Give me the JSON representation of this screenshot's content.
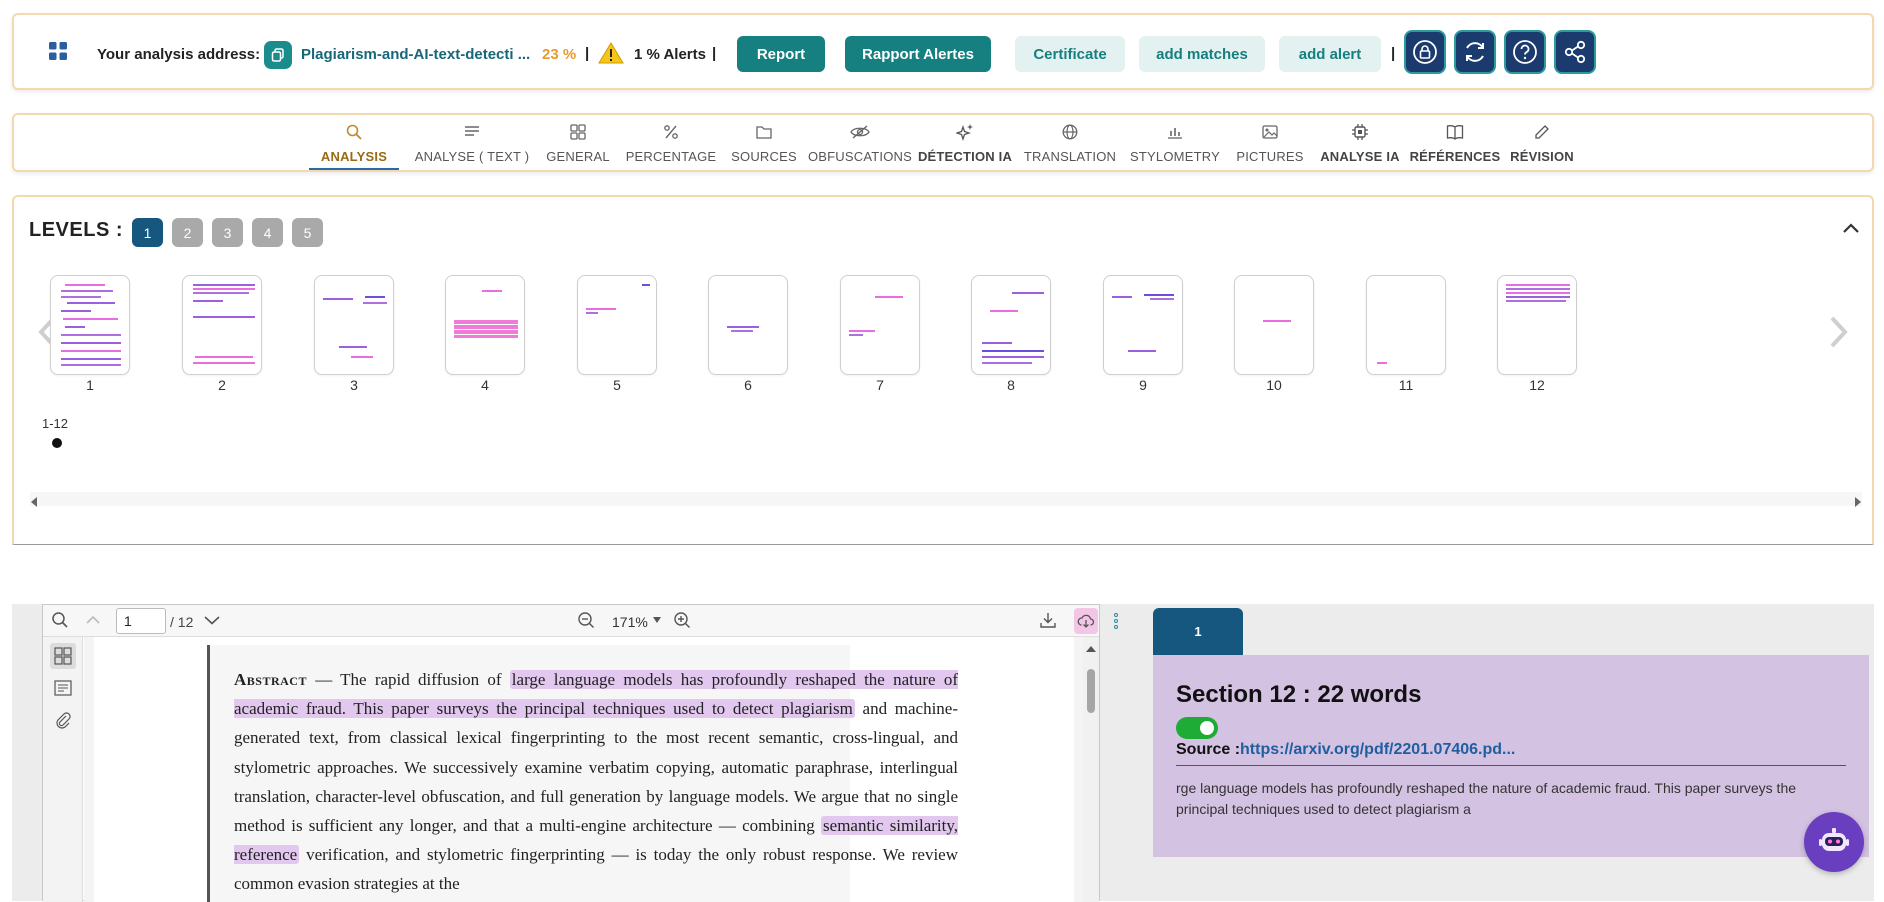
{
  "header": {
    "address_label": "Your analysis address:",
    "address_link": "Plagiarism-and-AI-text-detecti ...",
    "percentage": "23 %",
    "separator": "|",
    "alerts": "1 % Alerts",
    "report_button": "Report",
    "rapport_alertes_button": "Rapport Alertes",
    "certificate_button": "Certificate",
    "add_matches_button": "add matches",
    "add_alert_button": "add alert",
    "icons": [
      "apps-icon",
      "copy-icon",
      "warning-icon",
      "lock-icon",
      "refresh-icon",
      "help-icon",
      "share-icon"
    ],
    "colors": {
      "primary_button": "#167f80",
      "light_button": "#e3f2f1",
      "percentage": "#e89a2c",
      "icon_button": "#1b3a6e"
    }
  },
  "tabs": [
    {
      "label": "ANALYSIS",
      "icon": "search-icon",
      "active": true
    },
    {
      "label": "ANALYSE ( TEXT )",
      "icon": "text-lines-icon"
    },
    {
      "label": "GENERAL",
      "icon": "grid-icon"
    },
    {
      "label": "PERCENTAGE",
      "icon": "percent-icon"
    },
    {
      "label": "SOURCES",
      "icon": "folder-icon"
    },
    {
      "label": "OBFUSCATIONS",
      "icon": "eye-off-icon"
    },
    {
      "label": "DÉTECTION IA",
      "icon": "sparkle-icon"
    },
    {
      "label": "TRANSLATION",
      "icon": "globe-icon"
    },
    {
      "label": "STYLOMETRY",
      "icon": "bar-chart-icon"
    },
    {
      "label": "PICTURES",
      "icon": "image-icon"
    },
    {
      "label": "ANALYSE IA",
      "icon": "chip-icon"
    },
    {
      "label": "RÉFÉRENCES",
      "icon": "book-icon"
    },
    {
      "label": "RÉVISION",
      "icon": "pencil-icon"
    }
  ],
  "levels": {
    "title": "LEVELS :",
    "buttons": [
      "1",
      "2",
      "3",
      "4",
      "5"
    ],
    "selected": "1",
    "pages": [
      "1",
      "2",
      "3",
      "4",
      "5",
      "6",
      "7",
      "8",
      "9",
      "10",
      "11",
      "12"
    ],
    "range_label": "1-12"
  },
  "pdf": {
    "page_current": "1",
    "page_total": "/ 12",
    "zoom": "171%",
    "abstract_title": "Abstract",
    "abstract_dash": " — The rapid diffusion of ",
    "hl1": "large language models has profoundly reshaped the nature of academic fraud. This paper surveys the principal techniques used to detect plagiarism",
    "mid1": " and machine-generated text, from classical lexical fingerprinting to the most recent semantic, cross-lingual, and stylometric approaches. We successively examine verbatim copying, automatic paraphrase, interlingual translation, character-level obfuscation, and full generation by language models. We argue that no single method is sufficient any longer, and that a multi-engine architecture — combining ",
    "hl2": "semantic similarity, reference",
    "end": " verification, and stylometric fingerprinting — is today the only robust response. We review common evasion strategies at the",
    "highlight_color": "#e2c8ef"
  },
  "source": {
    "tab_label": "1",
    "title": "Section 12 : 22 words",
    "source_prefix": "Source :",
    "source_link": "https://arxiv.org/pdf/2201.07406.pd...",
    "excerpt": "rge language models has profoundly reshaped the nature of academic fraud. This paper surveys the principal techniques used to detect plagiarism a",
    "toggle_on": true,
    "panel_color": "#d4c2e3"
  }
}
